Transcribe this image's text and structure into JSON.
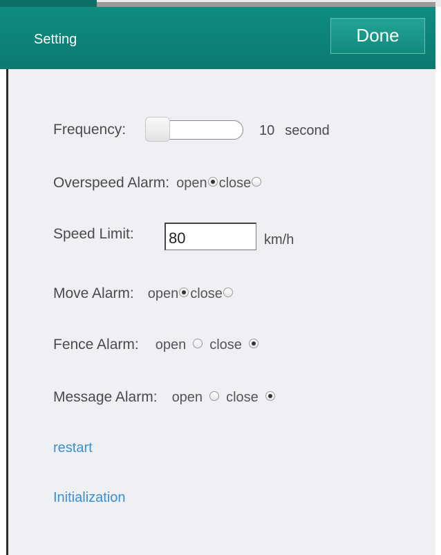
{
  "header": {
    "title": "Setting",
    "done_label": "Done"
  },
  "frequency": {
    "label": "Frequency:",
    "value": "10",
    "unit": "second",
    "slider_position": 0
  },
  "overspeed_alarm": {
    "label": "Overspeed Alarm:",
    "open_label": "open",
    "close_label": "close",
    "selected": "open"
  },
  "speed_limit": {
    "label": "Speed Limit:",
    "value": "80",
    "unit": "km/h"
  },
  "move_alarm": {
    "label": "Move Alarm:",
    "open_label": "open",
    "close_label": "close",
    "selected": "open"
  },
  "fence_alarm": {
    "label": "Fence Alarm:",
    "open_label": "open",
    "close_label": "close",
    "selected": "close"
  },
  "message_alarm": {
    "label": "Message Alarm:",
    "open_label": "open",
    "close_label": "close",
    "selected": "close"
  },
  "links": {
    "restart": "restart",
    "initialization": "Initialization"
  },
  "colors": {
    "header": "#0b7a70",
    "content_bg": "#eef0f3",
    "link": "#3a8fd0"
  }
}
